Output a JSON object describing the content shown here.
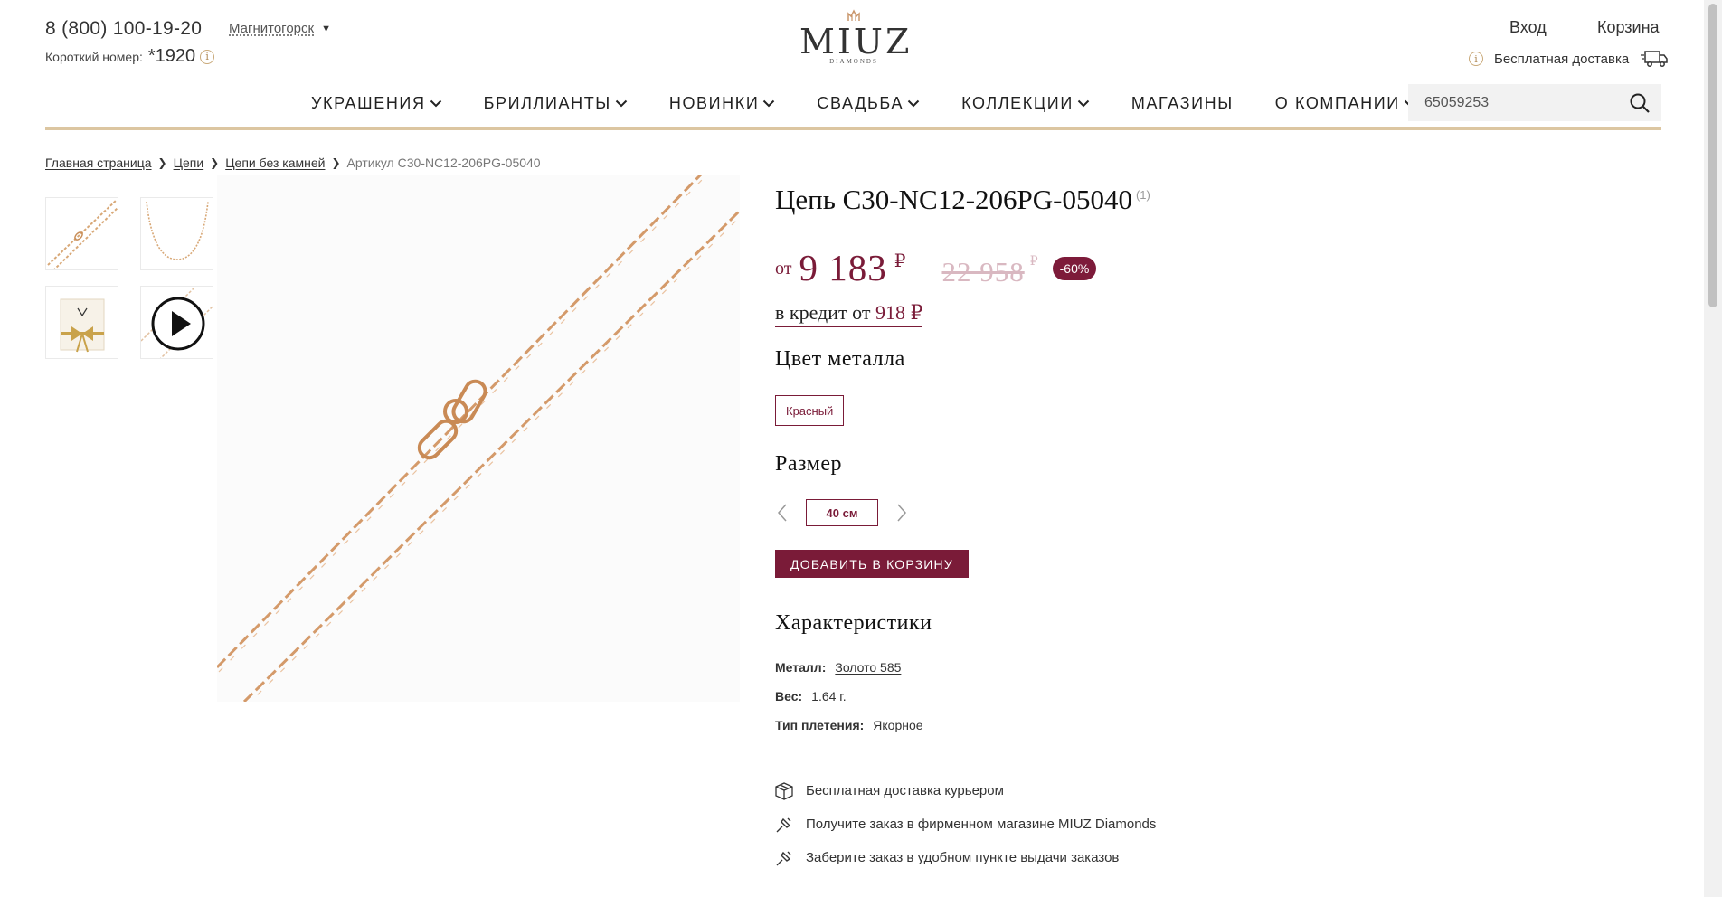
{
  "header": {
    "phone": "8 (800) 100-19-20",
    "short_label": "Короткий номер:",
    "short_number": "*1920",
    "city": "Магнитогорск",
    "logo_text": "MIUZ",
    "logo_sub": "DIAMONDS",
    "login": "Вход",
    "cart": "Корзина",
    "delivery": "Бесплатная доставка",
    "info_glyph": "i"
  },
  "nav": {
    "items": [
      {
        "label": "УКРАШЕНИЯ",
        "has_dropdown": true
      },
      {
        "label": "БРИЛЛИАНТЫ",
        "has_dropdown": true
      },
      {
        "label": "НОВИНКИ",
        "has_dropdown": true
      },
      {
        "label": "СВАДЬБА",
        "has_dropdown": true
      },
      {
        "label": "КОЛЛЕКЦИИ",
        "has_dropdown": true
      },
      {
        "label": "МАГАЗИНЫ",
        "has_dropdown": false
      },
      {
        "label": "О КОМПАНИИ",
        "has_dropdown": true
      }
    ]
  },
  "search": {
    "value": "65059253"
  },
  "breadcrumb": {
    "items": [
      "Главная страница",
      "Цепи",
      "Цепи без камней"
    ],
    "current": "Артикул C30-NC12-206PG-05040"
  },
  "gallery": {
    "thumbs": [
      "chain-closeup",
      "chain-full",
      "gift-box",
      "video-play-icon"
    ]
  },
  "product": {
    "title": "Цепь C30-NC12-206PG-05040",
    "title_note": "(1)",
    "price_prefix": "от",
    "price": "9 183",
    "currency": "₽",
    "old_price": "22 958",
    "old_currency": "₽",
    "discount": "-60%",
    "credit_prefix": "в кредит от",
    "credit_amount": "918 ₽",
    "color_heading": "Цвет металла",
    "color_value": "Красный",
    "size_heading": "Размер",
    "size_value": "40 см",
    "add_to_cart": "ДОБАВИТЬ В КОРЗИНУ"
  },
  "characteristics": {
    "heading": "Характеристики",
    "rows": [
      {
        "key": "Металл:",
        "value": "Золото 585"
      },
      {
        "key": "Вес:",
        "value": "1.64 г."
      },
      {
        "key": "Тип плетения:",
        "value": "Якорное"
      }
    ]
  },
  "perks": [
    {
      "icon": "box-icon",
      "text": "Бесплатная доставка курьером"
    },
    {
      "icon": "pin-icon",
      "text": "Получите заказ в фирменном магазине MIUZ Diamonds"
    },
    {
      "icon": "pin-icon",
      "text": "Заберите заказ в удобном пункте выдачи заказов"
    }
  ],
  "colors": {
    "accent": "#7a1b38",
    "gold_line": "#dcc6a1",
    "old_price": "#d9b8c1",
    "chain": "#d49a6a"
  }
}
